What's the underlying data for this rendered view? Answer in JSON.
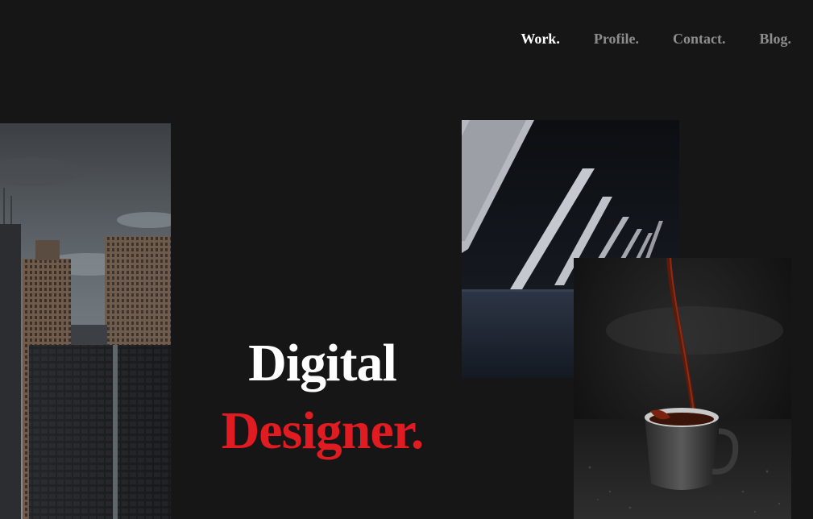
{
  "nav": {
    "items": [
      {
        "label": "Work.",
        "active": true
      },
      {
        "label": "Profile.",
        "active": false
      },
      {
        "label": "Contact.",
        "active": false
      },
      {
        "label": "Blog.",
        "active": false
      }
    ]
  },
  "hero": {
    "line1": "Digital",
    "line2": "Designer."
  },
  "colors": {
    "background": "#161616",
    "accent": "#e01b22",
    "nav_inactive": "#8d8d8d",
    "nav_active": "#ffffff"
  }
}
